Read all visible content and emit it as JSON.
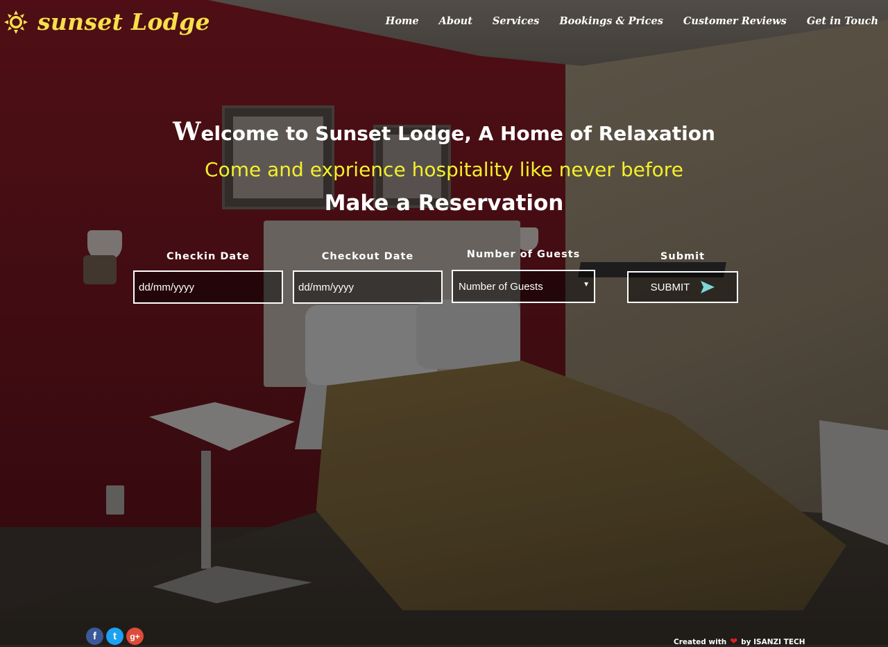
{
  "brand": {
    "name": "sunset Lodge",
    "logo_icon": "sun-icon",
    "accent_color": "#f7e04a"
  },
  "nav": {
    "items": [
      {
        "label": "Home"
      },
      {
        "label": "About"
      },
      {
        "label": "Services"
      },
      {
        "label": "Bookings & Prices"
      },
      {
        "label": "Customer Reviews"
      },
      {
        "label": "Get in Touch"
      }
    ]
  },
  "hero": {
    "welcome_initial": "W",
    "welcome_rest": "elcome to Sunset Lodge, A Home of Relaxation",
    "tagline": "Come and exprience hospitality like never before",
    "tagline_color": "#f4f02a",
    "reservation_title": "Make a Reservation"
  },
  "form": {
    "checkin": {
      "label": "Checkin Date",
      "placeholder": "dd/mm/yyyy"
    },
    "checkout": {
      "label": "Checkout Date",
      "placeholder": "dd/mm/yyyy"
    },
    "guests": {
      "label": "Number of Guests",
      "selected": "Number of Guests"
    },
    "submit": {
      "label": "Submit",
      "button_text": "SUBMIT",
      "icon": "send-icon",
      "icon_color": "#7fd6d8"
    }
  },
  "footer": {
    "socials": [
      {
        "name": "facebook-icon",
        "glyph": "f"
      },
      {
        "name": "twitter-icon",
        "glyph": "t"
      },
      {
        "name": "google-plus-icon",
        "glyph": "g+"
      }
    ],
    "credit_prefix": "Created with",
    "credit_suffix": "by ISANZI TECH"
  }
}
